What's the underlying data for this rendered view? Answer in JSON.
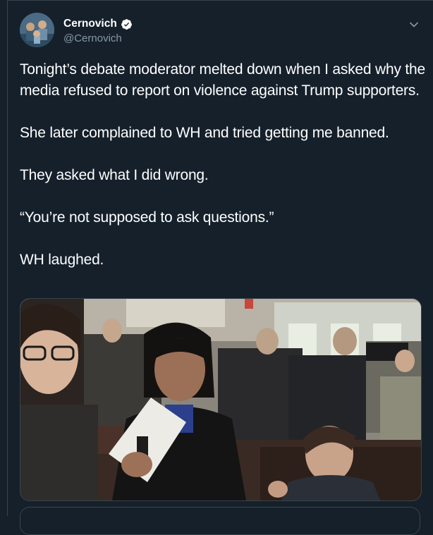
{
  "author": {
    "display_name": "Cernovich",
    "handle": "@Cernovich",
    "verified": true,
    "avatar": "profile-photo"
  },
  "tweet": {
    "paragraphs": [
      "Tonight’s debate moderator melted down when I asked why the media refused to report on violence against Trump supporters.",
      "She later complained to WH and tried getting me banned.",
      "They asked what I did wrong.",
      "“You’re not supposed to ask questions.”",
      "WH laughed."
    ]
  },
  "media": {
    "type": "photo",
    "scene": "press-room-crowd"
  },
  "icons": {
    "verified": "verified-badge-icon",
    "menu": "chevron-down-icon"
  },
  "colors": {
    "background": "#15202b",
    "border": "#38444d",
    "secondary_text": "#8899a6",
    "primary_text": "#ffffff"
  }
}
